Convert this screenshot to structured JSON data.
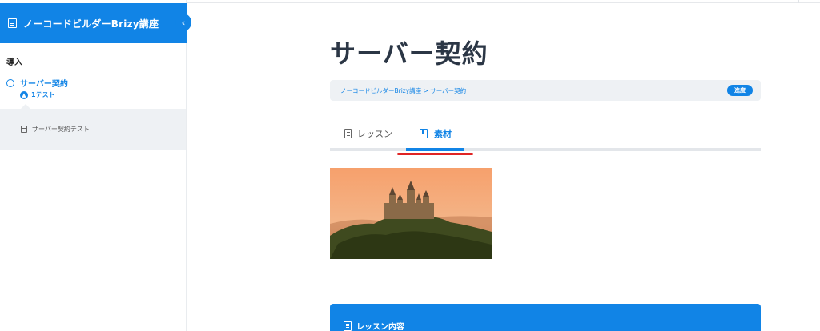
{
  "sidebar": {
    "course_title": "ノーコードビルダーBrizy講座",
    "collapse_glyph": "‹",
    "section_label": "導入",
    "lesson_label": "サーバー契約",
    "test_count_label": "1テスト",
    "test_item_label": "サーバー契約テスト"
  },
  "main": {
    "page_title": "サーバー契約",
    "breadcrumb": "ノーコードビルダーBrizy講座 > サーバー契約",
    "progress_badge": "進度",
    "tabs": [
      {
        "label": "レッスン",
        "icon": "document-icon",
        "active": false
      },
      {
        "label": "素材",
        "icon": "book-icon",
        "active": true
      }
    ],
    "image_subject": "castle-on-hill-photo",
    "content_panel_label": "レッスン内容"
  },
  "colors": {
    "accent": "#1184e6",
    "title_text": "#2b3645",
    "panel_bg": "#eef1f4",
    "annotation_red": "#e02424"
  }
}
